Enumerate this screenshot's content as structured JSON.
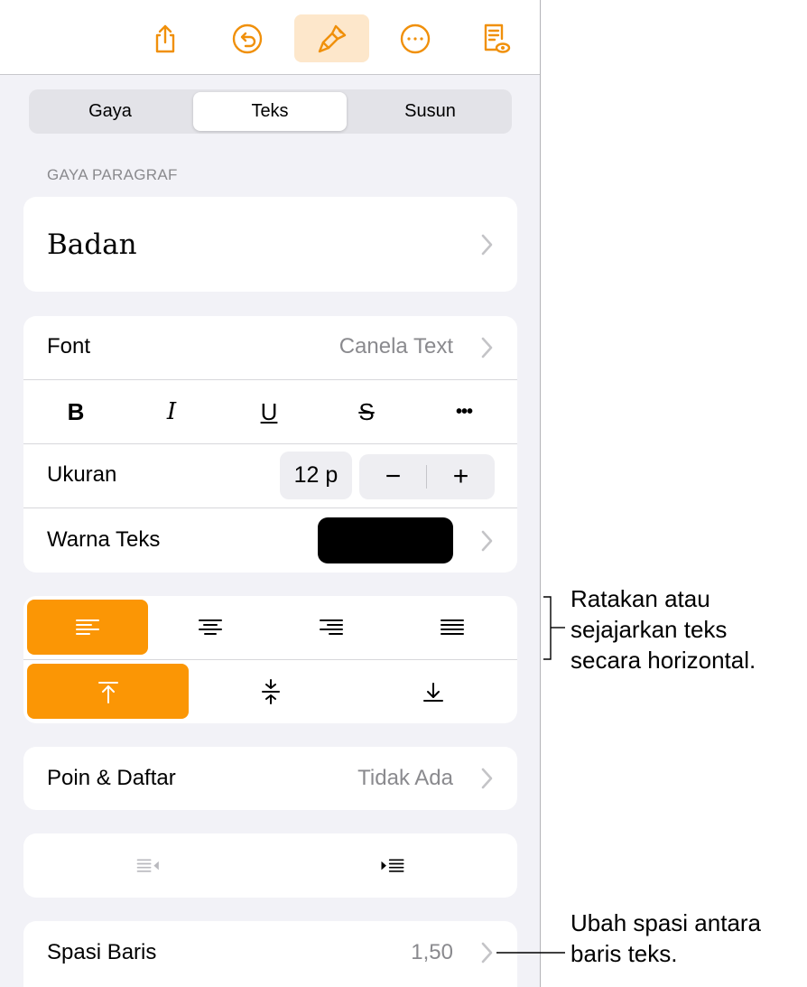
{
  "toolbar": {
    "icons": [
      "share-icon",
      "undo-icon",
      "paintbrush-icon",
      "more-icon",
      "reader-view-icon"
    ],
    "accent": "#f0900b",
    "active_bg": "#fde7cb"
  },
  "tabs": [
    {
      "label": "Gaya",
      "selected": false
    },
    {
      "label": "Teks",
      "selected": true
    },
    {
      "label": "Susun",
      "selected": false
    }
  ],
  "paragraph_style": {
    "section_label": "GAYA PARAGRAF",
    "value": "Badan"
  },
  "font": {
    "label": "Font",
    "value": "Canela Text",
    "styles": [
      "B",
      "I",
      "U",
      "S",
      "•••"
    ]
  },
  "size": {
    "label": "Ukuran",
    "value": "12 p",
    "minus": "−",
    "plus": "+"
  },
  "text_color": {
    "label": "Warna Teks",
    "color": "#000000"
  },
  "alignment": {
    "horizontal": [
      "align-left-icon",
      "align-center-icon",
      "align-right-icon",
      "align-justify-icon"
    ],
    "horizontal_selected": "align-left-icon",
    "vertical": [
      "align-top-icon",
      "align-middle-icon",
      "align-bottom-icon"
    ],
    "vertical_selected": "align-top-icon",
    "selected_color": "#fb9605"
  },
  "bullets": {
    "label": "Poin & Daftar",
    "value": "Tidak Ada"
  },
  "indent": {
    "buttons": [
      "decrease-indent-icon",
      "increase-indent-icon"
    ]
  },
  "line_spacing": {
    "label": "Spasi Baris",
    "value": "1,50"
  },
  "callouts": {
    "alignment": [
      "Ratakan atau",
      "sejajarkan teks",
      "secara horizontal."
    ],
    "spacing": [
      "Ubah spasi antara",
      "baris teks."
    ]
  }
}
